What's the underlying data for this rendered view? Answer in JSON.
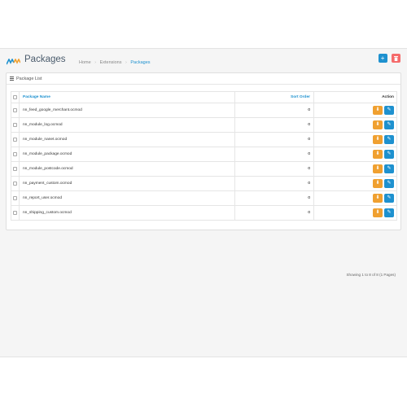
{
  "header": {
    "title": "Packages",
    "breadcrumbs": [
      {
        "label": "Home"
      },
      {
        "label": "Extensions"
      },
      {
        "label": "Packages"
      }
    ],
    "buttons": {
      "add_icon": "plus-icon",
      "delete_icon": "trash-icon"
    }
  },
  "panel": {
    "title": "Package List",
    "columns": {
      "name": "Package Name",
      "sort": "Sort Order",
      "action": "Action"
    },
    "rows": [
      {
        "name": "nn_feed_google_merchant.ocmod",
        "sort": "0"
      },
      {
        "name": "nn_module_log.ocmod",
        "sort": "0"
      },
      {
        "name": "nn_module_nanet.ocmod",
        "sort": "0"
      },
      {
        "name": "nn_module_package.ocmod",
        "sort": "0"
      },
      {
        "name": "nn_module_postcode.ocmod",
        "sort": "0"
      },
      {
        "name": "nn_payment_custom.ocmod",
        "sort": "0"
      },
      {
        "name": "nn_report_user.ocmod",
        "sort": "0"
      },
      {
        "name": "nn_shipping_custom.ocmod",
        "sort": "0"
      }
    ],
    "pagination_text": "Showing 1 to 8 of 8 (1 Pages)"
  },
  "colors": {
    "accent": "#1e91cf",
    "danger": "#f56b6b",
    "warning": "#f0a030"
  }
}
